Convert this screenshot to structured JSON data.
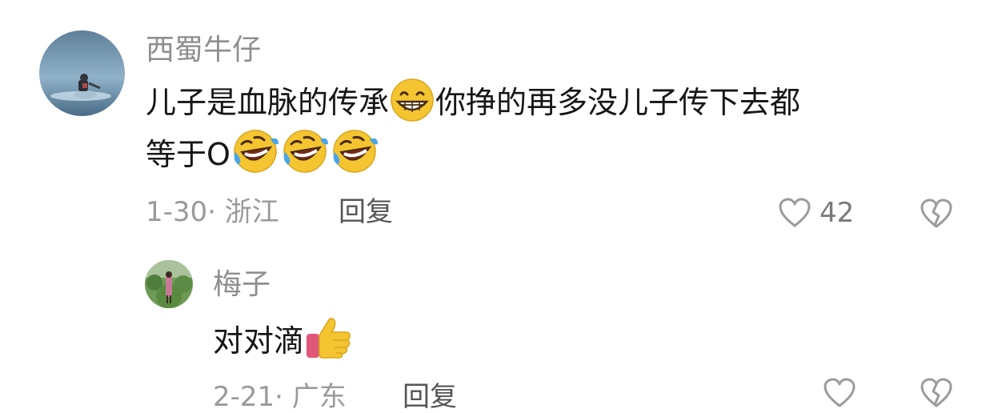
{
  "comments": [
    {
      "username": "西蜀牛仔",
      "text_line1_part1": "儿子是血脉的传承",
      "emoji_1": "grinning-face",
      "text_line1_part2": "你挣的再多没儿子传下去都",
      "text_line2": "等于O",
      "emoji_2": "rolling-on-the-floor-laughing",
      "emoji_3": "rolling-on-the-floor-laughing",
      "emoji_4": "rolling-on-the-floor-laughing",
      "date": "1-30",
      "location": "浙江",
      "reply_label": "回复",
      "like_count": "42",
      "avatar_icon": "landscape-avatar-icon"
    }
  ],
  "replies": [
    {
      "username": "梅子",
      "text": "对对滴",
      "emoji": "thumbs-up",
      "date": "2-21",
      "location": "广东",
      "reply_label": "回复",
      "avatar_icon": "person-in-field-avatar-icon"
    }
  ],
  "colors": {
    "username": "#8e8e8e",
    "text": "#161616",
    "meta": "#9a9a9a",
    "reply": "#555555",
    "icon_stroke": "#9b9b9b"
  }
}
